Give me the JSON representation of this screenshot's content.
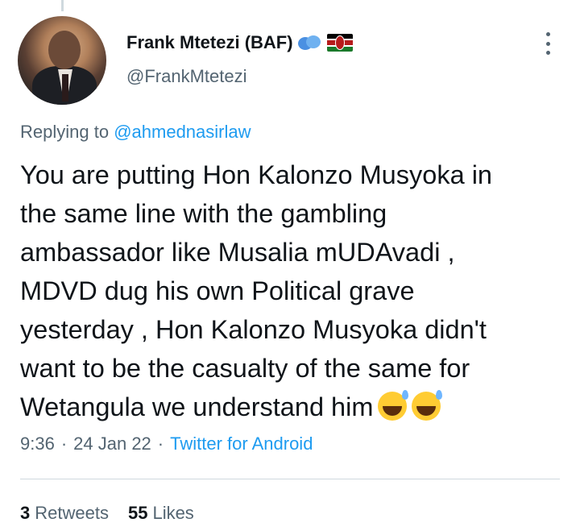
{
  "author": {
    "display_name": "Frank Mtetezi (BAF)",
    "handle": "@FrankMtetezi"
  },
  "reply": {
    "prefix": "Replying to",
    "to": "@ahmednasirlaw"
  },
  "tweet": {
    "lines": [
      "You are putting Hon Kalonzo Musyoka in",
      "the same line with the gambling",
      "ambassador like Musalia mUDAvadi ,",
      "MDVD dug his own Political grave",
      "yesterday , Hon Kalonzo Musyoka didn't",
      "want to be the casualty of the same for",
      "Wetangula we understand him"
    ]
  },
  "meta": {
    "time": "9:36",
    "date": "24 Jan 22",
    "separator": "·",
    "source": "Twitter for Android"
  },
  "stats": {
    "retweets_count": "3",
    "retweets_label": "Retweets",
    "likes_count": "55",
    "likes_label": "Likes"
  },
  "colors": {
    "text_primary": "#0f1419",
    "text_secondary": "#536471",
    "link": "#1d9bf0",
    "divider": "#cfd9de"
  }
}
